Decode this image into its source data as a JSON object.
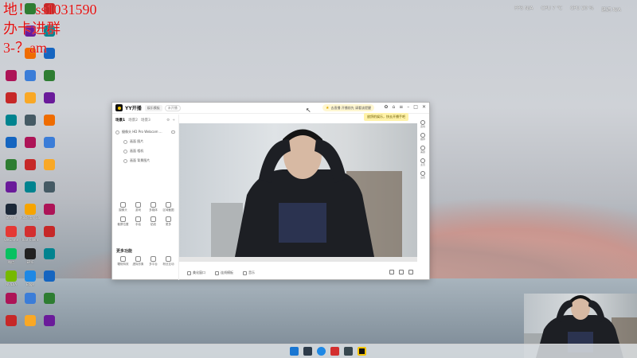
{
  "overlay": {
    "line1": "地！ ss1031590",
    "line2": "办卡进群",
    "line3": "3-？am"
  },
  "sysmon": {
    "fps": "FPS N/A",
    "cpu_temp": "CPU 7 ℃",
    "cpu_usage": "CPU 20 %",
    "latency": "延迟 N/A"
  },
  "desktop_icons": [
    {
      "label": "Steam",
      "color": "#1b2838"
    },
    {
      "label": "Rockstar Games",
      "color": "#f6a400"
    },
    {
      "label": "WeGame",
      "color": "#e53935"
    },
    {
      "label": "Riot Client",
      "color": "#d32f2f"
    },
    {
      "label": "微信",
      "color": "#07c160"
    },
    {
      "label": "EPIC",
      "color": "#222222"
    },
    {
      "label": "NVIDIA",
      "color": "#76b900"
    },
    {
      "label": "Edge",
      "color": "#1e88e5"
    }
  ],
  "app": {
    "name": "YY开播",
    "mode": "娱乐模板",
    "live_tag": "未开播",
    "notice": "去直播 开播前先 请看该提醒",
    "tooltip": "放鸽豹娱乐，快去开播手吧",
    "scene_tabs": [
      "场景1",
      "场景2",
      "场景3"
    ],
    "sources": [
      {
        "label": "摄像头 HD Pro Webcam ...",
        "child": false
      },
      {
        "label": "画面 图片",
        "child": true
      },
      {
        "label": "画面 相机",
        "child": true
      },
      {
        "label": "画面 背景图片",
        "child": true
      }
    ],
    "tools": [
      "摄像头",
      "游戏",
      "多媒体",
      "区域截图",
      "截屏位置",
      "手绘",
      "贴纸",
      "更多"
    ],
    "section_title": "更多功能",
    "tools2": [
      "鞭炮特效",
      "虚拟形象",
      "多平台",
      "粉丝互动"
    ],
    "bottom_bar": [
      "美化窗口",
      "连线模板",
      "音乐"
    ],
    "right_rail": [
      "连线",
      "推荐",
      "美颜",
      "主页",
      "设置"
    ]
  },
  "colors": {
    "overlay_red": "#e01010",
    "accent_yellow": "#f5c400"
  }
}
